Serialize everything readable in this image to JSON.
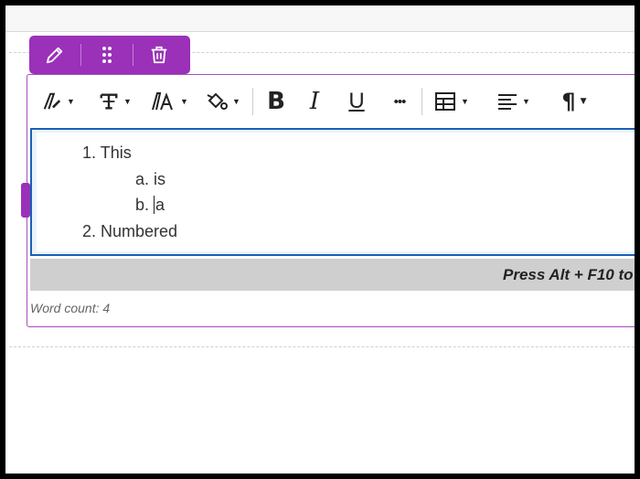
{
  "block_toolbar": {
    "buttons": [
      {
        "icon": "pencil-icon",
        "label": "Edit"
      },
      {
        "icon": "drag-handle-icon",
        "label": "Move"
      },
      {
        "icon": "trash-icon",
        "label": "Delete"
      }
    ]
  },
  "toolbar": {
    "tools": [
      {
        "icon": "text-style-icon",
        "dropdown": true
      },
      {
        "icon": "paragraph-format-icon",
        "dropdown": true
      },
      {
        "icon": "font-size-icon",
        "dropdown": true
      },
      {
        "icon": "text-color-icon",
        "dropdown": true
      },
      {
        "icon": "bold-icon",
        "glyph": "B"
      },
      {
        "icon": "italic-icon",
        "glyph": "I"
      },
      {
        "icon": "underline-icon",
        "glyph": "U"
      },
      {
        "icon": "more-icon",
        "glyph": "•••"
      },
      {
        "icon": "table-icon",
        "dropdown": true
      },
      {
        "icon": "align-icon",
        "dropdown": true
      },
      {
        "icon": "pilcrow-icon",
        "glyph": "¶",
        "dropdown": true
      }
    ]
  },
  "editor": {
    "list": [
      {
        "marker": "1.",
        "text": "This",
        "level": 1
      },
      {
        "marker": "a.",
        "text": "is",
        "level": 2
      },
      {
        "marker": "b.",
        "text": "a",
        "level": 2,
        "cursor": true
      },
      {
        "marker": "2.",
        "text": "Numbered",
        "level": 1
      }
    ],
    "help_text": "Press Alt + F10 to",
    "word_count": "Word count: 4"
  },
  "colors": {
    "accent": "#9a31b8",
    "focus_border": "#1a5fb4",
    "help_bar": "#cfcfcf"
  }
}
